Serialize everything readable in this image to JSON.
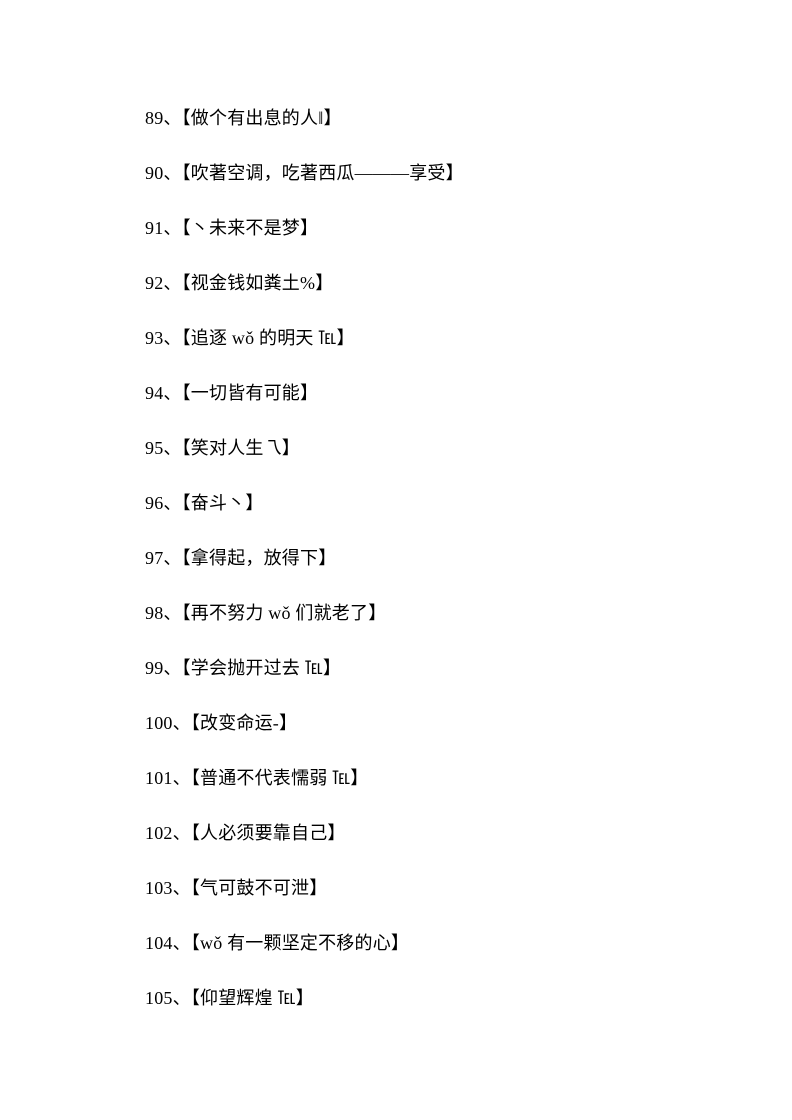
{
  "items": [
    {
      "num": "89",
      "text": "【做个有出息的人‖】"
    },
    {
      "num": "90",
      "text": "【吹著空调，吃著西瓜———享受】"
    },
    {
      "num": "91",
      "text": "【丶未来不是梦】"
    },
    {
      "num": "92",
      "text": "【视金钱如粪土%】"
    },
    {
      "num": "93",
      "text": "【追逐 wǒ 的明天 ℡】"
    },
    {
      "num": "94",
      "text": "【一切皆有可能】"
    },
    {
      "num": "95",
      "text": "【笑对人生乁】"
    },
    {
      "num": "96",
      "text": "【奋斗丶】"
    },
    {
      "num": "97",
      "text": "【拿得起，放得下】"
    },
    {
      "num": "98",
      "text": "【再不努力 wǒ 们就老了】"
    },
    {
      "num": "99",
      "text": "【学会抛开过去 ℡】"
    },
    {
      "num": "100",
      "text": "【改变命运-】"
    },
    {
      "num": "101",
      "text": "【普通不代表懦弱 ℡】"
    },
    {
      "num": "102",
      "text": "【人必须要靠自己】"
    },
    {
      "num": "103",
      "text": "【气可鼓不可泄】"
    },
    {
      "num": "104",
      "text": "【wǒ 有一颗坚定不移的心】"
    },
    {
      "num": "105",
      "text": "【仰望辉煌 ℡】"
    }
  ]
}
